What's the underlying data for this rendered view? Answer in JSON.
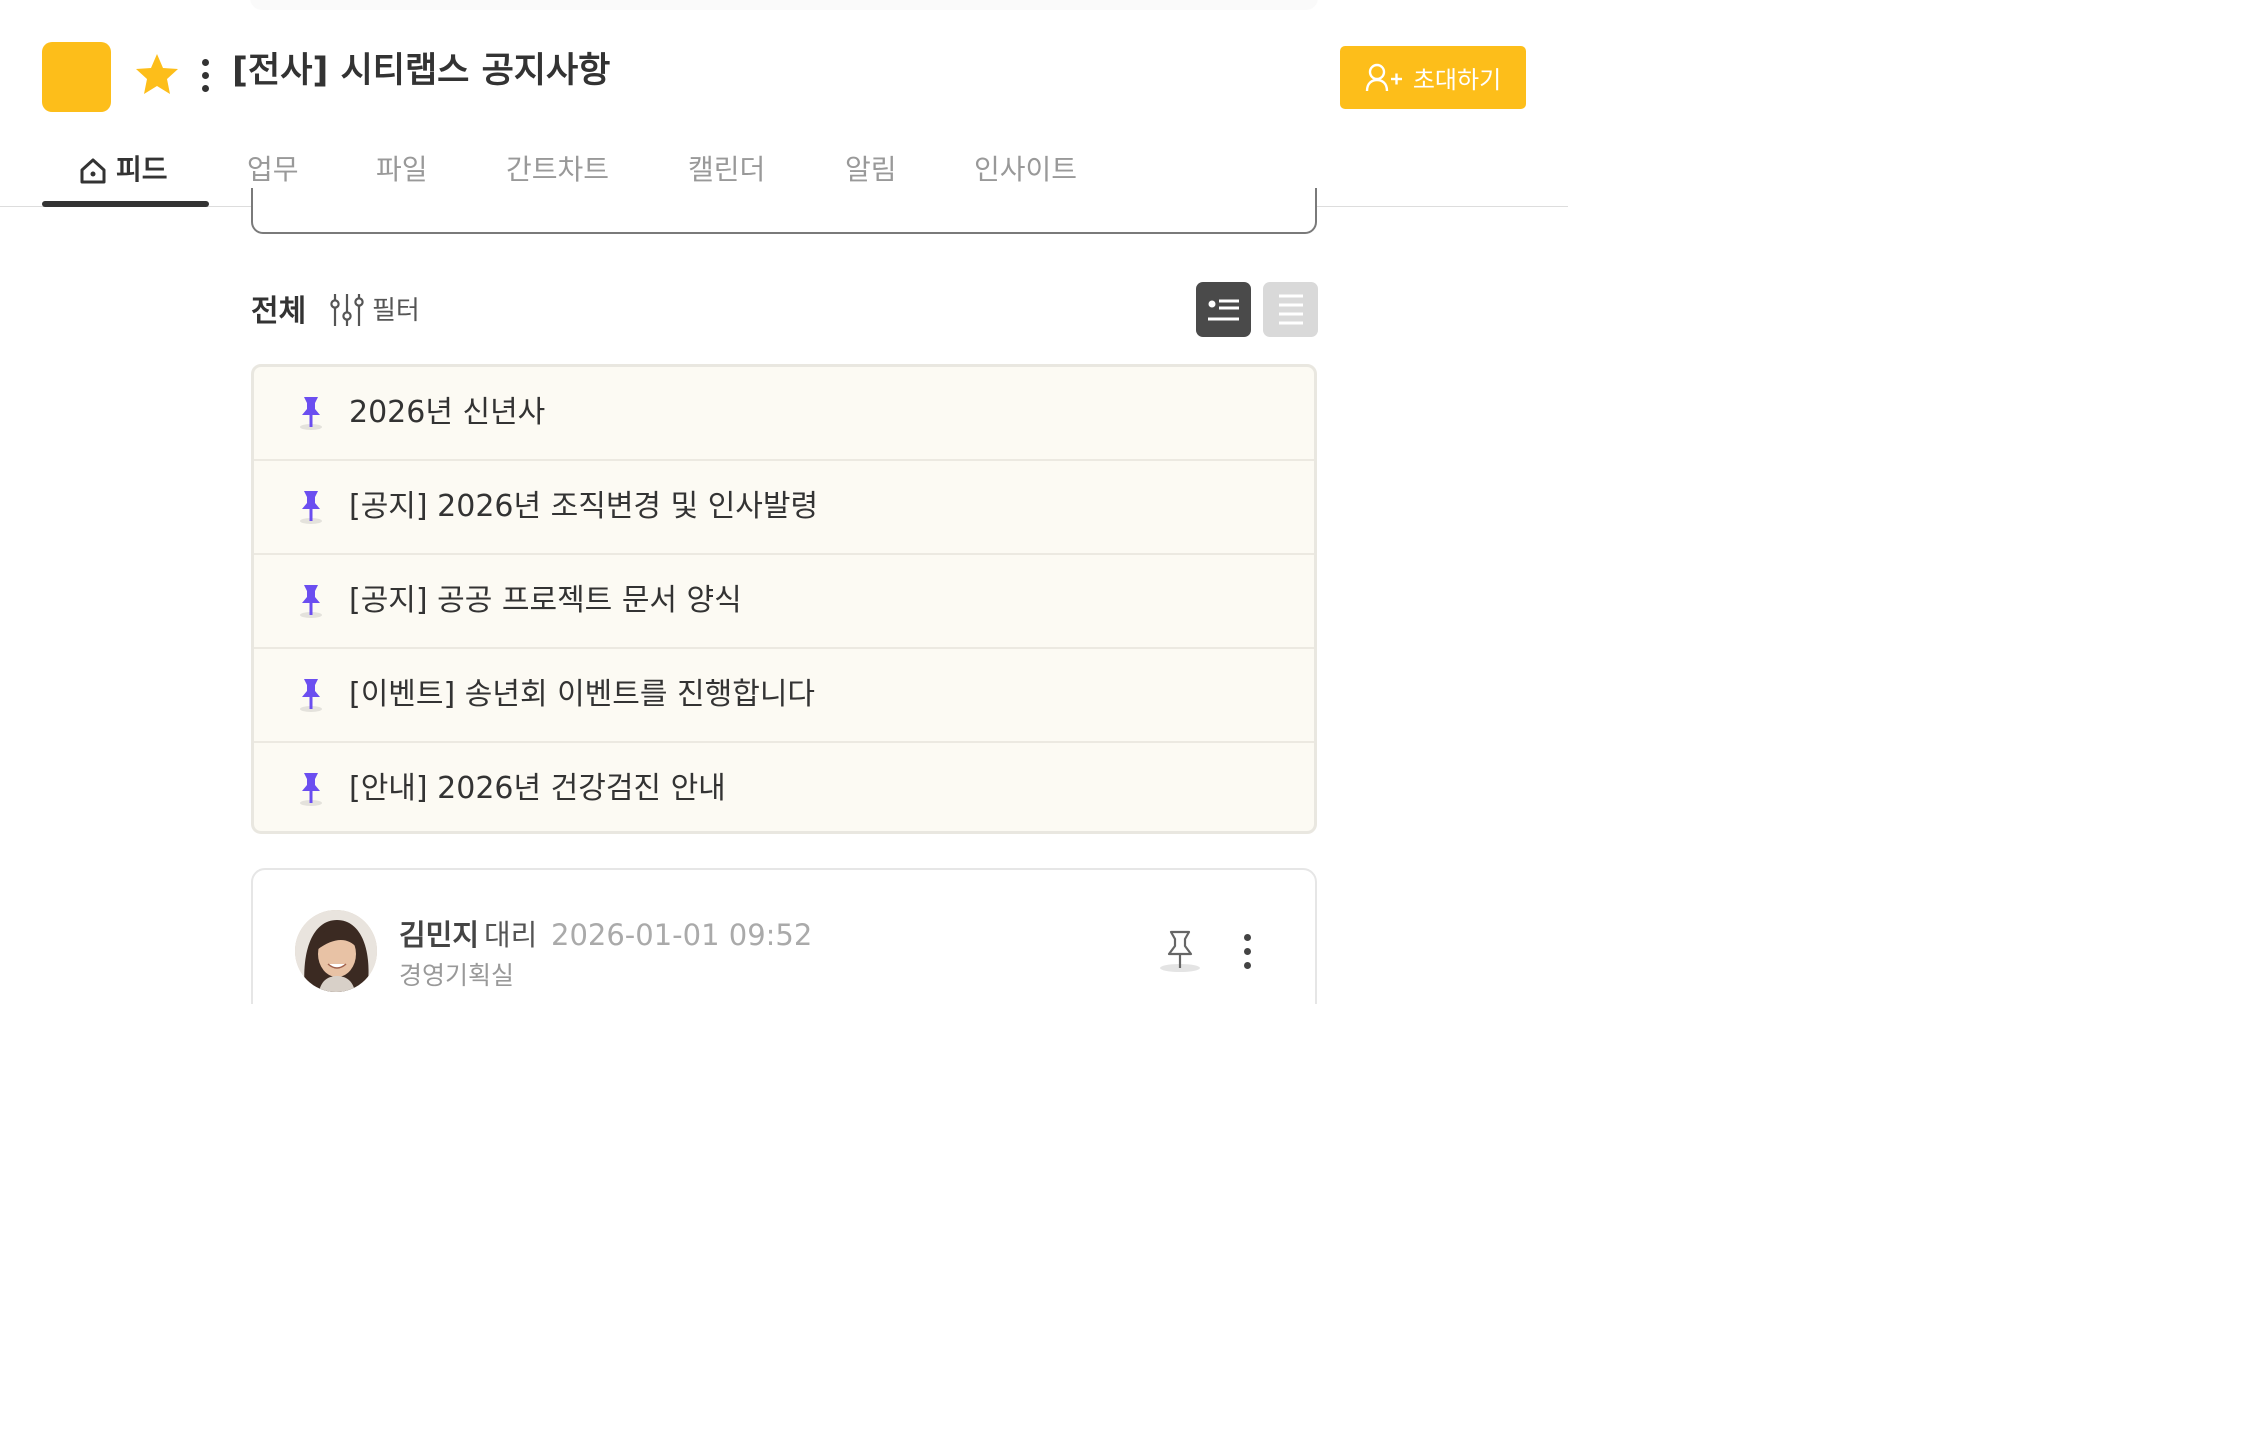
{
  "project": {
    "title": "[전사] 시티랩스 공지사항",
    "color": "#FDBE1A",
    "favorite": true
  },
  "header": {
    "invite_label": "초대하기",
    "invite_icon": "user-plus-icon"
  },
  "tabs": [
    {
      "label": "피드",
      "active": true,
      "icon": "home-icon"
    },
    {
      "label": "업무"
    },
    {
      "label": "파일"
    },
    {
      "label": "간트차트"
    },
    {
      "label": "캘린더"
    },
    {
      "label": "알림"
    },
    {
      "label": "인사이트"
    }
  ],
  "feed": {
    "section_title": "전체",
    "filter_label": "필터"
  },
  "pinned": [
    {
      "title": "2026년 신년사"
    },
    {
      "title": "[공지] 2026년 조직변경 및 인사발령"
    },
    {
      "title": "[공지] 공공 프로젝트 문서 양식"
    },
    {
      "title": "[이벤트] 송년회 이벤트를 진행합니다"
    },
    {
      "title": "[안내] 2026년 건강검진 안내"
    }
  ],
  "post": {
    "author_name": "김민지",
    "author_rank": "대리",
    "timestamp": "2026-01-01 09:52",
    "department": "경영기획실"
  },
  "colors": {
    "accent": "#FDBE1A",
    "pin": "#6B4EF0",
    "pinned_bg": "#FCFAF3"
  }
}
